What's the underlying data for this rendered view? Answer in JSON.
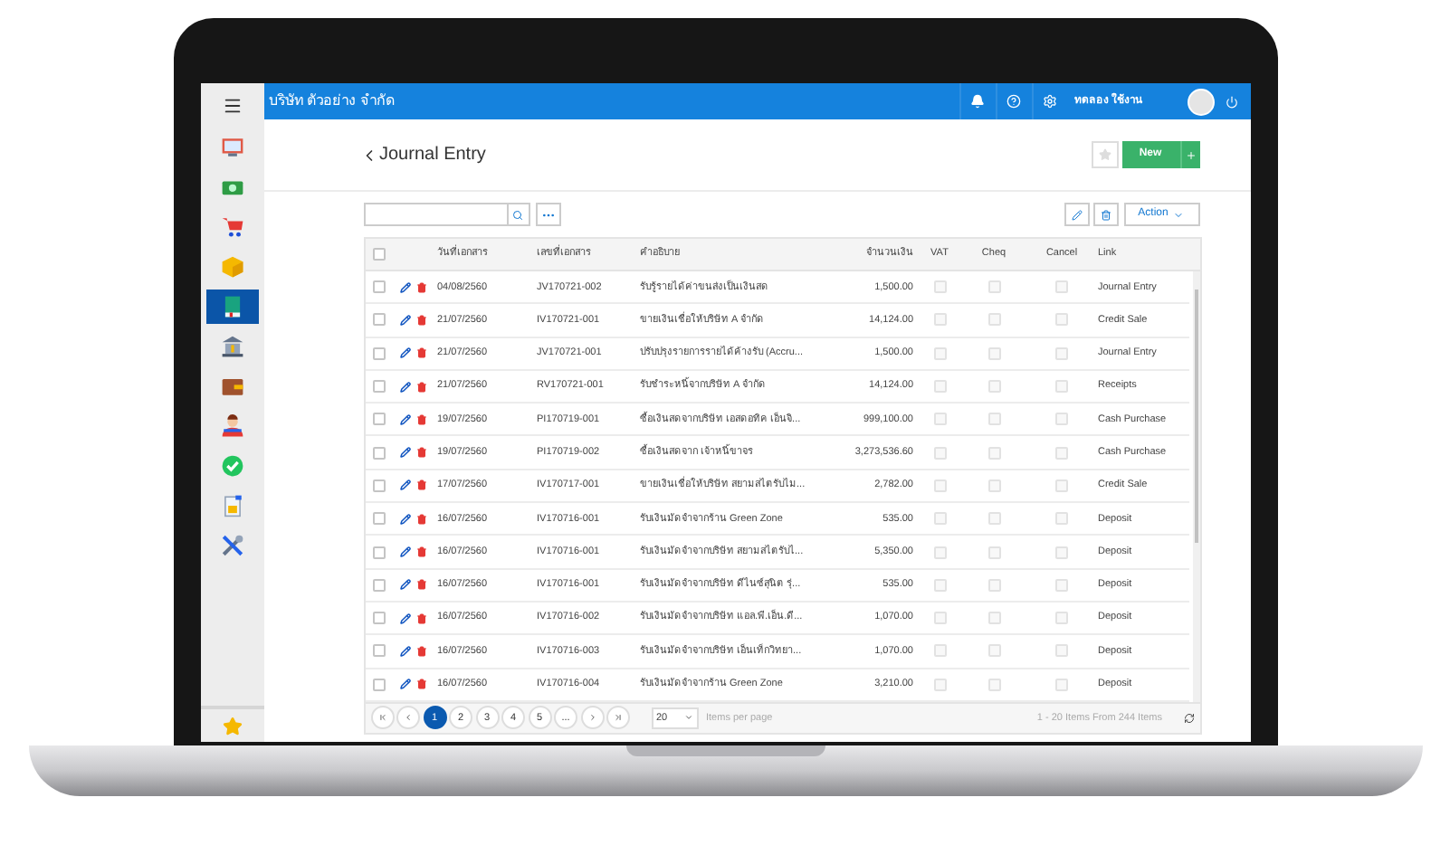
{
  "header": {
    "company": "บริษัท ตัวอย่าง จำกัด",
    "user": "ทดลอง ใช้งาน"
  },
  "sidebar": {
    "items": [
      {
        "kind": "monitor",
        "selected": false
      },
      {
        "kind": "money",
        "selected": false
      },
      {
        "kind": "cart",
        "selected": false
      },
      {
        "kind": "box",
        "selected": false
      },
      {
        "kind": "book",
        "selected": true
      },
      {
        "kind": "bank",
        "selected": false
      },
      {
        "kind": "wallet",
        "selected": false
      },
      {
        "kind": "person",
        "selected": false
      },
      {
        "kind": "check",
        "selected": false
      },
      {
        "kind": "document",
        "selected": false
      },
      {
        "kind": "tools",
        "selected": false
      }
    ]
  },
  "page": {
    "title": "Journal Entry",
    "new_button": "New",
    "action_button": "Action"
  },
  "table": {
    "header_checked": false,
    "columns": [
      "วันที่เอกสาร",
      "เลขที่เอกสาร",
      "คำอธิบาย",
      "จำนวนเงิน",
      "VAT",
      "Cheq",
      "Cancel",
      "Link"
    ],
    "rows": [
      {
        "date": "04/08/2560",
        "doc_no": "JV170721-002",
        "description": "รับรู้รายได้ค่าขนส่งเป็นเงินสด",
        "amount": "1,500.00",
        "link": "Journal Entry",
        "checked": false,
        "vat": false,
        "cheq": false,
        "cancel": false
      },
      {
        "date": "21/07/2560",
        "doc_no": "IV170721-001",
        "description": "ขายเงินเชื่อให้บริษัท A จำกัด",
        "amount": "14,124.00",
        "link": "Credit Sale",
        "checked": false,
        "vat": false,
        "cheq": false,
        "cancel": false
      },
      {
        "date": "21/07/2560",
        "doc_no": "JV170721-001",
        "description": "ปรับปรุงรายการรายได้ค้างรับ (Accru...",
        "amount": "1,500.00",
        "link": "Journal Entry",
        "checked": false,
        "vat": false,
        "cheq": false,
        "cancel": false
      },
      {
        "date": "21/07/2560",
        "doc_no": "RV170721-001",
        "description": "รับชำระหนี้จากบริษัท A จำกัด",
        "amount": "14,124.00",
        "link": "Receipts",
        "checked": false,
        "vat": false,
        "cheq": false,
        "cancel": false
      },
      {
        "date": "19/07/2560",
        "doc_no": "PI170719-001",
        "description": "ซื้อเงินสดจากบริษัท เอสดอทิค เอ็นจิ...",
        "amount": "999,100.00",
        "link": "Cash Purchase",
        "checked": false,
        "vat": false,
        "cheq": false,
        "cancel": false
      },
      {
        "date": "19/07/2560",
        "doc_no": "PI170719-002",
        "description": "ซื้อเงินสดจาก เจ้าหนี้ขาจร",
        "amount": "3,273,536.60",
        "link": "Cash Purchase",
        "checked": false,
        "vat": false,
        "cheq": false,
        "cancel": false
      },
      {
        "date": "17/07/2560",
        "doc_no": "IV170717-001",
        "description": "ขายเงินเชื่อให้บริษัท สยามสไตรับไม...",
        "amount": "2,782.00",
        "link": "Credit Sale",
        "checked": false,
        "vat": false,
        "cheq": false,
        "cancel": false
      },
      {
        "date": "16/07/2560",
        "doc_no": "IV170716-001",
        "description": "รับเงินมัดจำจากร้าน Green Zone",
        "amount": "535.00",
        "link": "Deposit",
        "checked": false,
        "vat": false,
        "cheq": false,
        "cancel": false
      },
      {
        "date": "16/07/2560",
        "doc_no": "IV170716-001",
        "description": "รับเงินมัดจำจากบริษัท สยามสไตรับไ...",
        "amount": "5,350.00",
        "link": "Deposit",
        "checked": false,
        "vat": false,
        "cheq": false,
        "cancel": false
      },
      {
        "date": "16/07/2560",
        "doc_no": "IV170716-001",
        "description": "รับเงินมัดจำจากบริษัท ดีไนซ์สุนิต รุ่...",
        "amount": "535.00",
        "link": "Deposit",
        "checked": false,
        "vat": false,
        "cheq": false,
        "cancel": false
      },
      {
        "date": "16/07/2560",
        "doc_no": "IV170716-002",
        "description": "รับเงินมัดจำจากบริษัท แอล.พี.เอ็น.ดี...",
        "amount": "1,070.00",
        "link": "Deposit",
        "checked": false,
        "vat": false,
        "cheq": false,
        "cancel": false
      },
      {
        "date": "16/07/2560",
        "doc_no": "IV170716-003",
        "description": "รับเงินมัดจำจากบริษัท เอ็นเท็กวิทยา...",
        "amount": "1,070.00",
        "link": "Deposit",
        "checked": false,
        "vat": false,
        "cheq": false,
        "cancel": false
      },
      {
        "date": "16/07/2560",
        "doc_no": "IV170716-004",
        "description": "รับเงินมัดจำจากร้าน Green Zone",
        "amount": "3,210.00",
        "link": "Deposit",
        "checked": false,
        "vat": false,
        "cheq": false,
        "cancel": false
      }
    ]
  },
  "pager": {
    "pages": [
      {
        "label": "1",
        "selected": true
      },
      {
        "label": "2",
        "selected": false
      },
      {
        "label": "3",
        "selected": false
      },
      {
        "label": "4",
        "selected": false
      },
      {
        "label": "5",
        "selected": false
      },
      {
        "label": "...",
        "selected": false
      }
    ],
    "page_size": "20",
    "page_size_label": "Items per page",
    "summary": "1 - 20 Items From 244 Items"
  }
}
